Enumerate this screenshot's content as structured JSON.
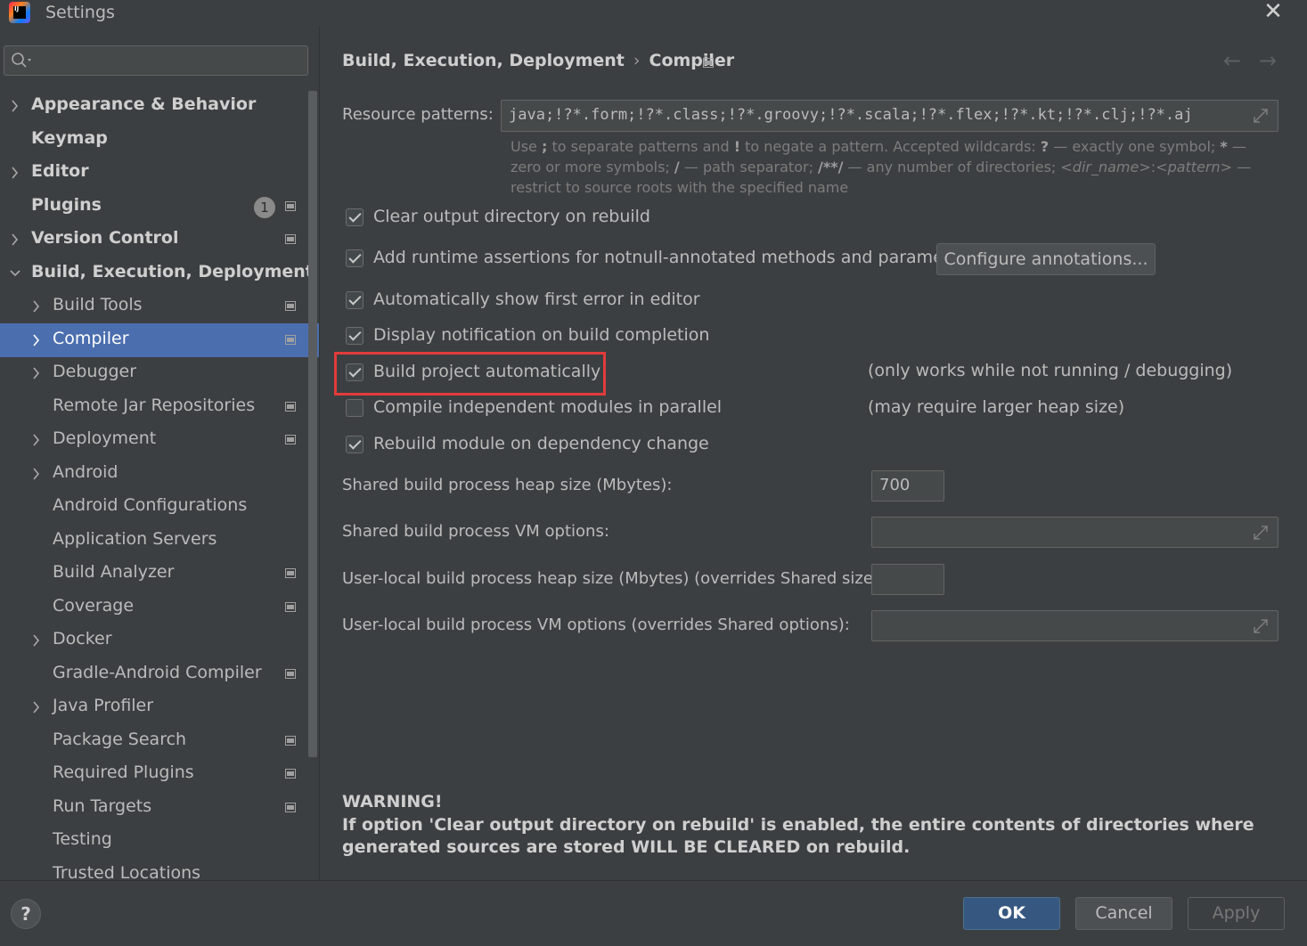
{
  "window": {
    "title": "Settings",
    "close_glyph": "✕"
  },
  "search": {
    "placeholder": ""
  },
  "sidebar": {
    "items": [
      {
        "label": "Appearance & Behavior",
        "bold": true,
        "chevron": "right",
        "level": 0
      },
      {
        "label": "Keymap",
        "bold": true,
        "chevron": "none",
        "level": 0
      },
      {
        "label": "Editor",
        "bold": true,
        "chevron": "right",
        "level": 0
      },
      {
        "label": "Plugins",
        "bold": true,
        "chevron": "none",
        "level": 0,
        "badge": "1",
        "project_icon": true
      },
      {
        "label": "Version Control",
        "bold": true,
        "chevron": "right",
        "level": 0,
        "project_icon": true
      },
      {
        "label": "Build, Execution, Deployment",
        "bold": true,
        "chevron": "down",
        "level": 0
      },
      {
        "label": "Build Tools",
        "chevron": "right",
        "level": 1,
        "project_icon": true
      },
      {
        "label": "Compiler",
        "chevron": "right",
        "level": 1,
        "project_icon": true,
        "selected": true
      },
      {
        "label": "Debugger",
        "chevron": "right",
        "level": 1
      },
      {
        "label": "Remote Jar Repositories",
        "chevron": "none",
        "level": 1,
        "project_icon": true
      },
      {
        "label": "Deployment",
        "chevron": "right",
        "level": 1,
        "project_icon": true
      },
      {
        "label": "Android",
        "chevron": "right",
        "level": 1
      },
      {
        "label": "Android Configurations",
        "chevron": "none",
        "level": 1
      },
      {
        "label": "Application Servers",
        "chevron": "none",
        "level": 1
      },
      {
        "label": "Build Analyzer",
        "chevron": "none",
        "level": 1,
        "project_icon": true
      },
      {
        "label": "Coverage",
        "chevron": "none",
        "level": 1,
        "project_icon": true
      },
      {
        "label": "Docker",
        "chevron": "right",
        "level": 1
      },
      {
        "label": "Gradle-Android Compiler",
        "chevron": "none",
        "level": 1,
        "project_icon": true
      },
      {
        "label": "Java Profiler",
        "chevron": "right",
        "level": 1
      },
      {
        "label": "Package Search",
        "chevron": "none",
        "level": 1,
        "project_icon": true
      },
      {
        "label": "Required Plugins",
        "chevron": "none",
        "level": 1,
        "project_icon": true
      },
      {
        "label": "Run Targets",
        "chevron": "none",
        "level": 1,
        "project_icon": true
      },
      {
        "label": "Testing",
        "chevron": "none",
        "level": 1
      },
      {
        "label": "Trusted Locations",
        "chevron": "none",
        "level": 1
      }
    ]
  },
  "header": {
    "breadcrumb_parent": "Build, Execution, Deployment",
    "breadcrumb_sep": "›",
    "breadcrumb_current": "Compiler",
    "back_glyph": "←",
    "forward_glyph": "→"
  },
  "resource": {
    "label": "Resource patterns:",
    "value": "java;!?*.form;!?*.class;!?*.groovy;!?*.scala;!?*.flex;!?*.kt;!?*.clj;!?*.aj",
    "hint_html": "Use <b>;</b> to separate patterns and <b>!</b> to negate a pattern. Accepted wildcards: <b>?</b> — exactly one symbol; <b>*</b> — zero or more symbols; <b>/</b> — path separator; <b>/**/</b> — any number of directories; <i>&lt;dir_name&gt;</i>:<i>&lt;pattern&gt;</i> — restrict to source roots with the specified name"
  },
  "options": {
    "clear_output": {
      "label": "Clear output directory on rebuild",
      "checked": true
    },
    "runtime_assertions": {
      "label": "Add runtime assertions for notnull-annotated methods and parameters",
      "checked": true
    },
    "configure_annotations": "Configure annotations...",
    "show_first_error": {
      "label": "Automatically show first error in editor",
      "checked": true
    },
    "display_notification": {
      "label": "Display notification on build completion",
      "checked": true
    },
    "build_automatically": {
      "label": "Build project automatically",
      "checked": true,
      "note": "(only works while not running / debugging)"
    },
    "compile_parallel": {
      "label": "Compile independent modules in parallel",
      "checked": false,
      "note": "(may require larger heap size)"
    },
    "rebuild_on_change": {
      "label": "Rebuild module on dependency change",
      "checked": true
    }
  },
  "fields": {
    "shared_heap_label": "Shared build process heap size (Mbytes):",
    "shared_heap_value": "700",
    "shared_vm_label": "Shared build process VM options:",
    "shared_vm_value": "",
    "user_heap_label": "User-local build process heap size (Mbytes) (overrides Shared size):",
    "user_heap_value": "",
    "user_vm_label": "User-local build process VM options (overrides Shared options):",
    "user_vm_value": ""
  },
  "warning": {
    "title": "WARNING!",
    "text": "If option 'Clear output directory on rebuild' is enabled, the entire contents of directories where generated sources are stored WILL BE CLEARED on rebuild."
  },
  "footer": {
    "help": "?",
    "ok": "OK",
    "cancel": "Cancel",
    "apply": "Apply"
  }
}
